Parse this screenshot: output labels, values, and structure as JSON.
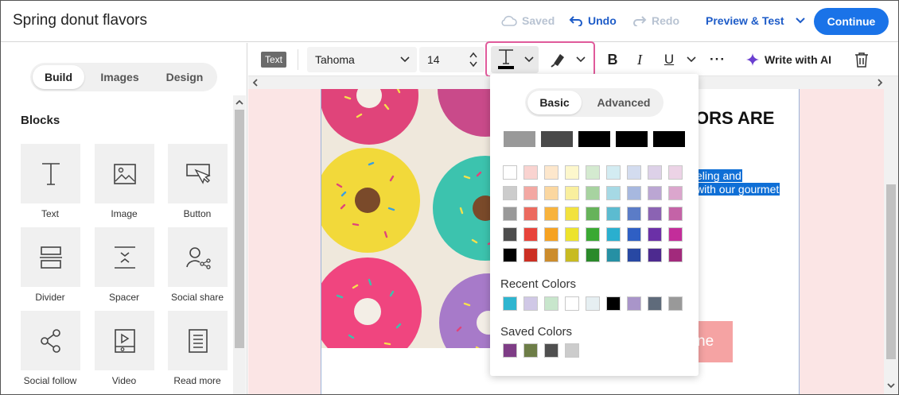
{
  "header": {
    "title": "Spring donut flavors",
    "saved_label": "Saved",
    "undo_label": "Undo",
    "redo_label": "Redo",
    "preview_label": "Preview & Test",
    "continue_label": "Continue"
  },
  "left_panel": {
    "tabs": [
      "Build",
      "Images",
      "Design"
    ],
    "active_tab": "Build",
    "section_title": "Blocks",
    "blocks": [
      {
        "label": "Text",
        "icon": "text-icon"
      },
      {
        "label": "Image",
        "icon": "image-icon"
      },
      {
        "label": "Button",
        "icon": "button-icon"
      },
      {
        "label": "Divider",
        "icon": "divider-icon"
      },
      {
        "label": "Spacer",
        "icon": "spacer-icon"
      },
      {
        "label": "Social share",
        "icon": "social-share-icon"
      },
      {
        "label": "Social follow",
        "icon": "social-follow-icon"
      },
      {
        "label": "Video",
        "icon": "video-icon"
      },
      {
        "label": "Read more",
        "icon": "read-more-icon"
      }
    ]
  },
  "toolbar": {
    "element_type": "Text",
    "font": "Tahoma",
    "font_size": "14",
    "write_ai_label": "Write with AI"
  },
  "canvas": {
    "heading_fragment": "ORS ARE",
    "selected_line_1": "eling and",
    "selected_line_2": "with our gourmet",
    "button_fragment": "ne"
  },
  "color_picker": {
    "tabs": [
      "Basic",
      "Advanced"
    ],
    "active_tab": "Basic",
    "top_row": [
      "#999999",
      "#4a4a4a",
      "#000000",
      "#000000",
      "#000000"
    ],
    "grid": [
      [
        "#ffffff",
        "#f9d3d0",
        "#fde7cc",
        "#fdf7cc",
        "#d4ead0",
        "#d3ecf2",
        "#d3dcef",
        "#ddd1e8",
        "#ecd3e6"
      ],
      [
        "#cccccc",
        "#f3a8a3",
        "#fbd7a0",
        "#f9ef9e",
        "#a7d3a0",
        "#a6d9e5",
        "#a7b8df",
        "#bba6d3",
        "#dba6cd"
      ],
      [
        "#999999",
        "#ec6a5f",
        "#f8b33c",
        "#f2e23e",
        "#66b35a",
        "#5cbbd0",
        "#5b7cc7",
        "#8b63b3",
        "#c463a7"
      ],
      [
        "#4d4d4d",
        "#e8433a",
        "#f6a221",
        "#ede32c",
        "#3aa933",
        "#2aafcf",
        "#2f5fc4",
        "#6b30a7",
        "#c32d9a"
      ],
      [
        "#000000",
        "#cc2f23",
        "#cc8c2c",
        "#c8bb22",
        "#2a8a2a",
        "#2690a4",
        "#2848a3",
        "#4d2a8f",
        "#a22a7c"
      ]
    ],
    "recent_label": "Recent Colors",
    "recent": [
      "#2eb5d0",
      "#d0c8e6",
      "#c8e6cc",
      "#ffffff",
      "#e6eff2",
      "#000000",
      "#a995c9",
      "#5f6b7b",
      "#999999"
    ],
    "saved_label": "Saved Colors",
    "saved": [
      "#7e3d86",
      "#6d7d47",
      "#4f4f4f",
      "#cccccc"
    ]
  }
}
